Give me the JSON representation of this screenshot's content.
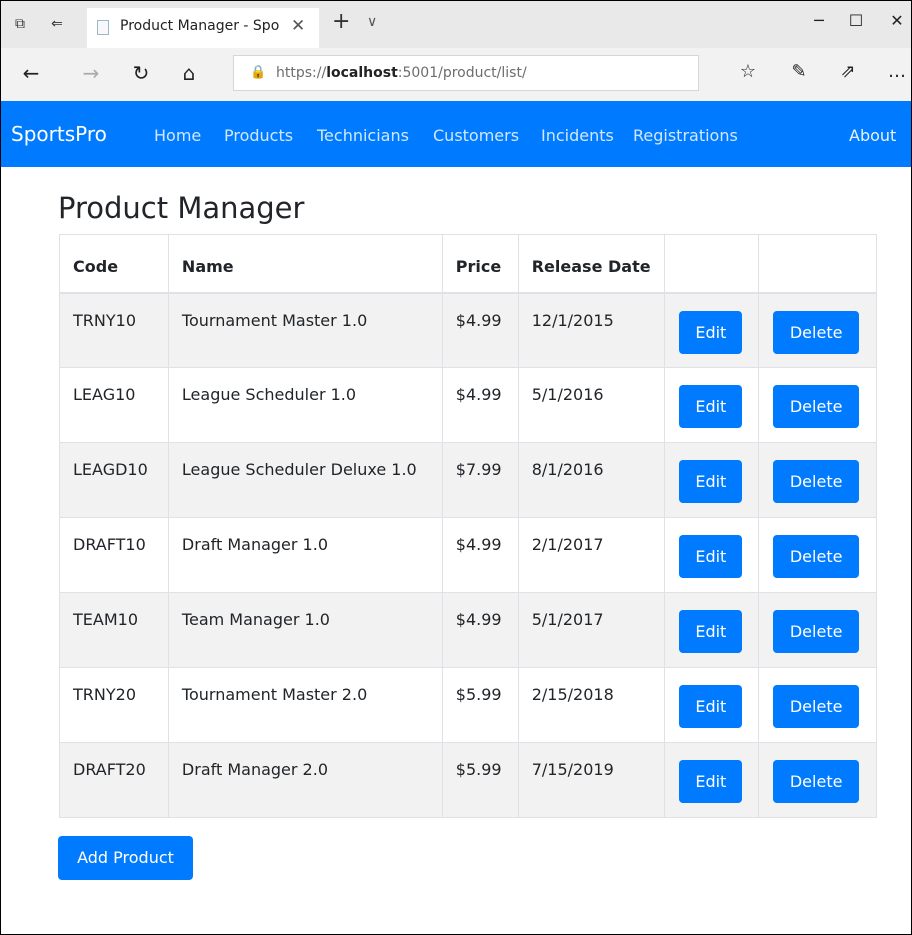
{
  "browser": {
    "tab_title": "Product Manager - Spo",
    "url_prefix": "https://",
    "url_host": "localhost",
    "url_rest": ":5001/product/list/",
    "icons": {
      "tab_actions": "tab-actions-icon",
      "back_tabs": "tabs-aside-icon",
      "new_tab": "+",
      "tab_menu": "∨",
      "close_tab": "✕",
      "minimize": "─",
      "maximize": "☐",
      "close_window": "✕",
      "back": "←",
      "forward": "→",
      "refresh": "↻",
      "home": "⌂",
      "lock": "🔒",
      "favorites": "☆",
      "notes": "✎",
      "share": "⇗",
      "more": "…"
    }
  },
  "navbar": {
    "brand": "SportsPro",
    "links": [
      "Home",
      "Products",
      "Technicians",
      "Customers",
      "Incidents",
      "Registrations"
    ],
    "about": "About",
    "color": "#007bff"
  },
  "page": {
    "title": "Product Manager",
    "columns": [
      "Code",
      "Name",
      "Price",
      "Release Date"
    ],
    "rows": [
      {
        "code": "TRNY10",
        "name": "Tournament Master 1.0",
        "price": "$4.99",
        "date": "12/1/2015"
      },
      {
        "code": "LEAG10",
        "name": "League Scheduler 1.0",
        "price": "$4.99",
        "date": "5/1/2016"
      },
      {
        "code": "LEAGD10",
        "name": "League Scheduler Deluxe 1.0",
        "price": "$7.99",
        "date": "8/1/2016"
      },
      {
        "code": "DRAFT10",
        "name": "Draft Manager 1.0",
        "price": "$4.99",
        "date": "2/1/2017"
      },
      {
        "code": "TEAM10",
        "name": "Team Manager 1.0",
        "price": "$4.99",
        "date": "5/1/2017"
      },
      {
        "code": "TRNY20",
        "name": "Tournament Master 2.0",
        "price": "$5.99",
        "date": "2/15/2018"
      },
      {
        "code": "DRAFT20",
        "name": "Draft Manager 2.0",
        "price": "$5.99",
        "date": "7/15/2019"
      }
    ],
    "edit_label": "Edit",
    "delete_label": "Delete",
    "add_label": "Add Product"
  }
}
